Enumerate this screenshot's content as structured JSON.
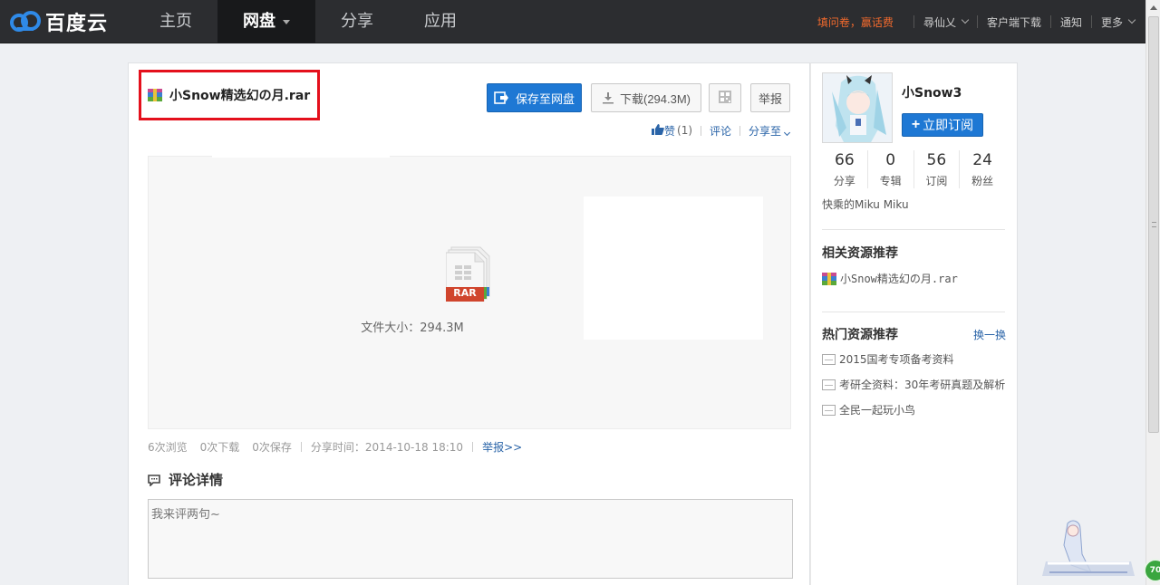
{
  "app": {
    "logo_text": "百度云",
    "nav": [
      {
        "label": "主页"
      },
      {
        "label": "网盘"
      },
      {
        "label": "分享"
      },
      {
        "label": "应用"
      }
    ],
    "top_right": {
      "promo": "填问卷，赢话费",
      "user": "尋仙乂",
      "client_download": "客户端下载",
      "notify": "通知",
      "more": "更多"
    },
    "colors": {
      "topbar": "#2c2d30",
      "accent_blue": "#1e78d4",
      "promo_orange": "#f26a2d",
      "highlight_red": "#e4101c"
    }
  },
  "file": {
    "icon": "rar-file-icon",
    "name": "小Snow精选幻の月.rar",
    "save_label": "保存至网盘",
    "download_label": "下载(294.3M)",
    "report_label": "举报",
    "like_label": "赞",
    "like_count": "(1)",
    "comment_label": "评论",
    "share_label": "分享至",
    "preview_type": "RAR",
    "size_text": "文件大小：294.3M",
    "stats": {
      "views": "6次浏览",
      "downloads": "0次下载",
      "saves": "0次保存",
      "share_time": "分享时间：2014-10-18 18:10",
      "report_link": "举报>>"
    }
  },
  "comments": {
    "title": "评论详情",
    "placeholder": "我来评两句~"
  },
  "sidebar": {
    "username": "小Snow3",
    "subscribe_label": "立即订阅",
    "counts": [
      {
        "value": "66",
        "label": "分享"
      },
      {
        "value": "0",
        "label": "专辑"
      },
      {
        "value": "56",
        "label": "订阅"
      },
      {
        "value": "24",
        "label": "粉丝"
      }
    ],
    "bio": "快乘的Miku Miku",
    "related_title": "相关资源推荐",
    "related_items": [
      {
        "name": "小Snow精选幻の月.rar"
      }
    ],
    "hot_title": "热门资源推荐",
    "hot_swap": "换一换",
    "hot_items": [
      {
        "name": "2015国考专项备考资料"
      },
      {
        "name": "考研全资料：30年考研真题及解析"
      },
      {
        "name": "全民一起玩小鸟"
      }
    ]
  },
  "watermark": {
    "badge": "70"
  }
}
